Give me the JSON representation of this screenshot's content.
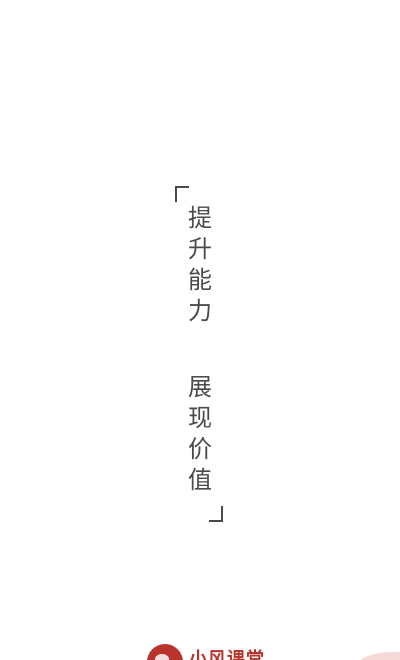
{
  "splash": {
    "slogan_line_1": [
      "提",
      "升",
      "能",
      "力"
    ],
    "slogan_line_2": [
      "展",
      "现",
      "价",
      "值"
    ]
  },
  "brand": {
    "name": "小风课堂",
    "accent_color": "#b8332b",
    "logo_icon": "brand-logo-icon"
  }
}
